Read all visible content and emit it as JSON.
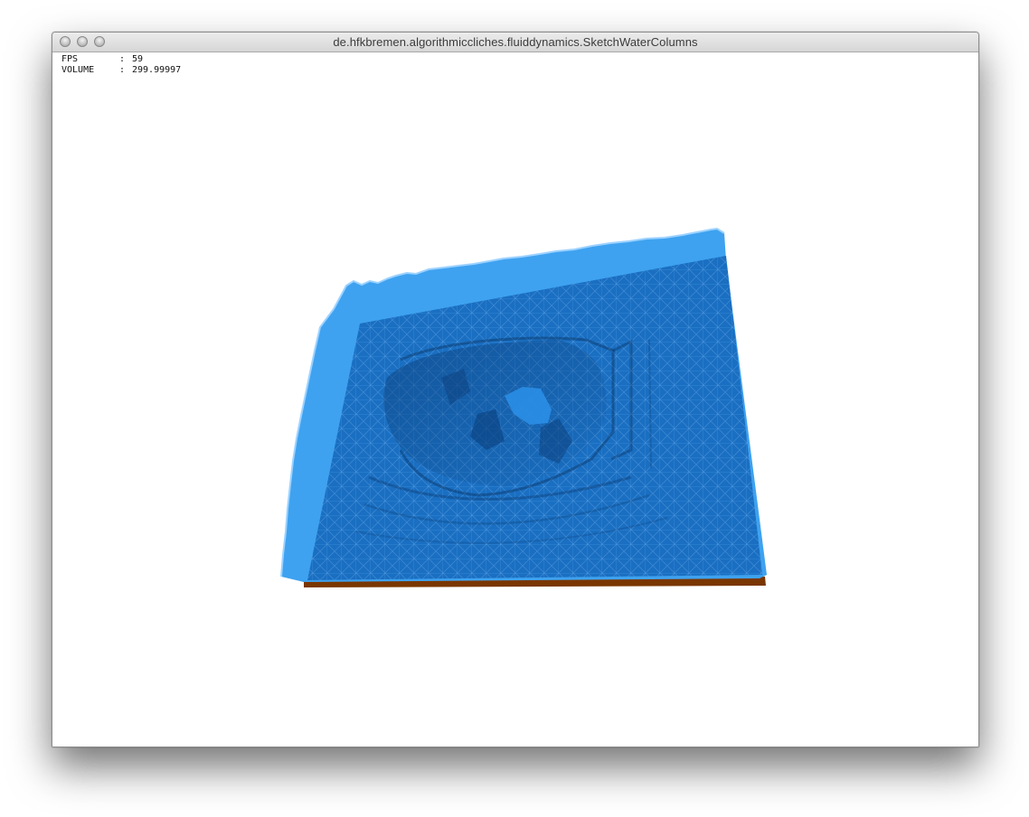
{
  "window": {
    "title": "de.hfkbremen.algorithmiccliches.fluiddynamics.SketchWaterColumns"
  },
  "stats": [
    {
      "label": "FPS",
      "separator": ":",
      "value": "59"
    },
    {
      "label": "VOLUME",
      "separator": ":",
      "value": "299.99997"
    }
  ],
  "scene": {
    "water_color": "#2a8ee6",
    "water_deep_color": "#1a6fc2",
    "water_edge_color": "#3ea2f0",
    "ground_color": "#7a3600",
    "highlight_color": "#9dd2ff"
  }
}
